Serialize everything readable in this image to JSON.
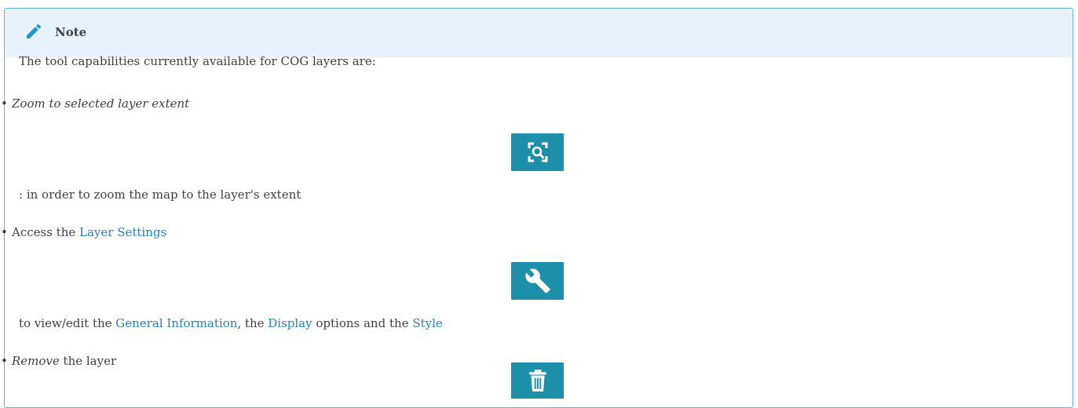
{
  "note": {
    "title": "Note",
    "intro": "The tool capabilities currently available for COG layers are:",
    "items": [
      {
        "bullet": "•",
        "lead": "Zoom to selected layer extent",
        "icon": "zoom-to-extent-icon",
        "continuation": ": in order to zoom the map to the layer's extent"
      },
      {
        "bullet": "•",
        "lead_prefix": "Access the ",
        "lead_link": "Layer Settings",
        "icon": "wrench-icon",
        "continuation_prefix": "to view/edit the ",
        "link_general": "General Information",
        "sep1": ", the ",
        "link_display": "Display",
        "sep2": " options and the ",
        "link_style": "Style"
      },
      {
        "bullet": "•",
        "lead_em": "Remove",
        "lead_rest": " the layer",
        "icon": "trash-icon"
      }
    ]
  },
  "colors": {
    "title_bg": "#e7f2fa",
    "border": "#6ab0de",
    "link": "#2980b9",
    "icon_bg": "#1e8fa8",
    "pencil": "#2196c8"
  }
}
